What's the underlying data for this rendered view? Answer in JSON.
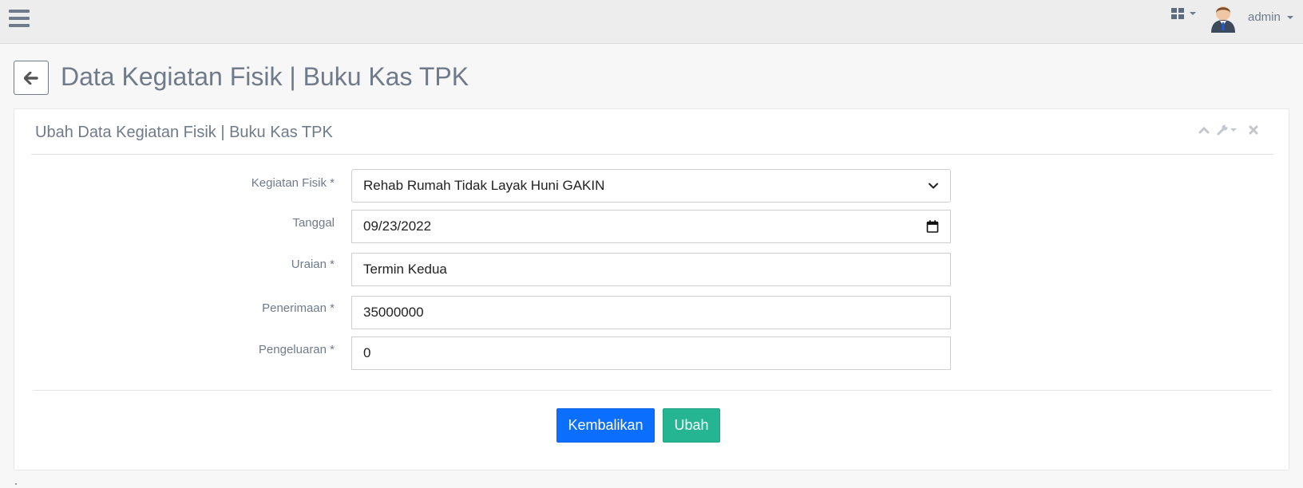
{
  "header": {
    "menu_icon": "hamburger-menu-icon",
    "apps_icon": "grid-icon",
    "avatar": "user-avatar",
    "user_name": "admin"
  },
  "page": {
    "back_icon": "arrow-left-icon",
    "title": "Data Kegiatan Fisik | Buku Kas TPK"
  },
  "panel": {
    "title": "Ubah Data Kegiatan Fisik | Buku Kas TPK",
    "tools": [
      "chevron-up-icon",
      "wrench-icon",
      "close-icon"
    ]
  },
  "form": {
    "kegiatan": {
      "label": "Kegiatan Fisik *",
      "value": "Rehab Rumah Tidak Layak Huni GAKIN"
    },
    "tanggal": {
      "label": "Tanggal",
      "value": "09/23/2022"
    },
    "uraian": {
      "label": "Uraian *",
      "value": "Termin Kedua"
    },
    "penerimaan": {
      "label": "Penerimaan *",
      "value": "35000000"
    },
    "pengeluaran": {
      "label": "Pengeluaran *",
      "value": "0"
    }
  },
  "actions": {
    "reset_label": "Kembalikan",
    "submit_label": "Ubah"
  },
  "colors": {
    "accent_text": "#6f7b8a",
    "primary_button": "#0b6efd",
    "success_button": "#26b593",
    "topbar": "#ededed",
    "page_background": "#f7f7f7"
  }
}
